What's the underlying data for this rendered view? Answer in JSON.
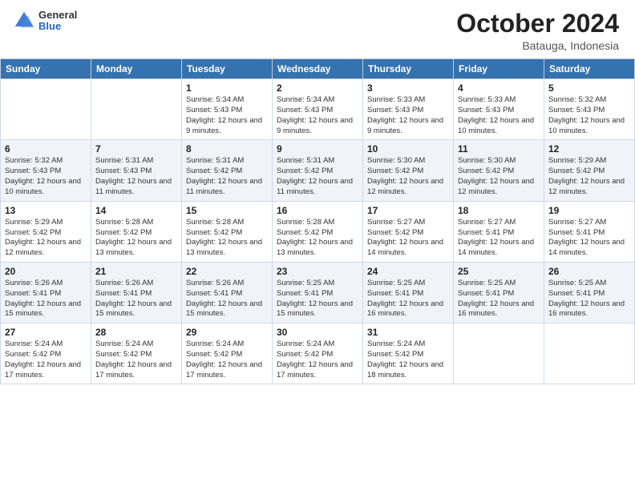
{
  "logo": {
    "general": "General",
    "blue": "Blue"
  },
  "header": {
    "month_year": "October 2024",
    "location": "Batauga, Indonesia"
  },
  "weekdays": [
    "Sunday",
    "Monday",
    "Tuesday",
    "Wednesday",
    "Thursday",
    "Friday",
    "Saturday"
  ],
  "weeks": [
    [
      {
        "day": "",
        "sunrise": "",
        "sunset": "",
        "daylight": ""
      },
      {
        "day": "",
        "sunrise": "",
        "sunset": "",
        "daylight": ""
      },
      {
        "day": "1",
        "sunrise": "Sunrise: 5:34 AM",
        "sunset": "Sunset: 5:43 PM",
        "daylight": "Daylight: 12 hours and 9 minutes."
      },
      {
        "day": "2",
        "sunrise": "Sunrise: 5:34 AM",
        "sunset": "Sunset: 5:43 PM",
        "daylight": "Daylight: 12 hours and 9 minutes."
      },
      {
        "day": "3",
        "sunrise": "Sunrise: 5:33 AM",
        "sunset": "Sunset: 5:43 PM",
        "daylight": "Daylight: 12 hours and 9 minutes."
      },
      {
        "day": "4",
        "sunrise": "Sunrise: 5:33 AM",
        "sunset": "Sunset: 5:43 PM",
        "daylight": "Daylight: 12 hours and 10 minutes."
      },
      {
        "day": "5",
        "sunrise": "Sunrise: 5:32 AM",
        "sunset": "Sunset: 5:43 PM",
        "daylight": "Daylight: 12 hours and 10 minutes."
      }
    ],
    [
      {
        "day": "6",
        "sunrise": "Sunrise: 5:32 AM",
        "sunset": "Sunset: 5:43 PM",
        "daylight": "Daylight: 12 hours and 10 minutes."
      },
      {
        "day": "7",
        "sunrise": "Sunrise: 5:31 AM",
        "sunset": "Sunset: 5:43 PM",
        "daylight": "Daylight: 12 hours and 11 minutes."
      },
      {
        "day": "8",
        "sunrise": "Sunrise: 5:31 AM",
        "sunset": "Sunset: 5:42 PM",
        "daylight": "Daylight: 12 hours and 11 minutes."
      },
      {
        "day": "9",
        "sunrise": "Sunrise: 5:31 AM",
        "sunset": "Sunset: 5:42 PM",
        "daylight": "Daylight: 12 hours and 11 minutes."
      },
      {
        "day": "10",
        "sunrise": "Sunrise: 5:30 AM",
        "sunset": "Sunset: 5:42 PM",
        "daylight": "Daylight: 12 hours and 12 minutes."
      },
      {
        "day": "11",
        "sunrise": "Sunrise: 5:30 AM",
        "sunset": "Sunset: 5:42 PM",
        "daylight": "Daylight: 12 hours and 12 minutes."
      },
      {
        "day": "12",
        "sunrise": "Sunrise: 5:29 AM",
        "sunset": "Sunset: 5:42 PM",
        "daylight": "Daylight: 12 hours and 12 minutes."
      }
    ],
    [
      {
        "day": "13",
        "sunrise": "Sunrise: 5:29 AM",
        "sunset": "Sunset: 5:42 PM",
        "daylight": "Daylight: 12 hours and 12 minutes."
      },
      {
        "day": "14",
        "sunrise": "Sunrise: 5:28 AM",
        "sunset": "Sunset: 5:42 PM",
        "daylight": "Daylight: 12 hours and 13 minutes."
      },
      {
        "day": "15",
        "sunrise": "Sunrise: 5:28 AM",
        "sunset": "Sunset: 5:42 PM",
        "daylight": "Daylight: 12 hours and 13 minutes."
      },
      {
        "day": "16",
        "sunrise": "Sunrise: 5:28 AM",
        "sunset": "Sunset: 5:42 PM",
        "daylight": "Daylight: 12 hours and 13 minutes."
      },
      {
        "day": "17",
        "sunrise": "Sunrise: 5:27 AM",
        "sunset": "Sunset: 5:42 PM",
        "daylight": "Daylight: 12 hours and 14 minutes."
      },
      {
        "day": "18",
        "sunrise": "Sunrise: 5:27 AM",
        "sunset": "Sunset: 5:41 PM",
        "daylight": "Daylight: 12 hours and 14 minutes."
      },
      {
        "day": "19",
        "sunrise": "Sunrise: 5:27 AM",
        "sunset": "Sunset: 5:41 PM",
        "daylight": "Daylight: 12 hours and 14 minutes."
      }
    ],
    [
      {
        "day": "20",
        "sunrise": "Sunrise: 5:26 AM",
        "sunset": "Sunset: 5:41 PM",
        "daylight": "Daylight: 12 hours and 15 minutes."
      },
      {
        "day": "21",
        "sunrise": "Sunrise: 5:26 AM",
        "sunset": "Sunset: 5:41 PM",
        "daylight": "Daylight: 12 hours and 15 minutes."
      },
      {
        "day": "22",
        "sunrise": "Sunrise: 5:26 AM",
        "sunset": "Sunset: 5:41 PM",
        "daylight": "Daylight: 12 hours and 15 minutes."
      },
      {
        "day": "23",
        "sunrise": "Sunrise: 5:25 AM",
        "sunset": "Sunset: 5:41 PM",
        "daylight": "Daylight: 12 hours and 15 minutes."
      },
      {
        "day": "24",
        "sunrise": "Sunrise: 5:25 AM",
        "sunset": "Sunset: 5:41 PM",
        "daylight": "Daylight: 12 hours and 16 minutes."
      },
      {
        "day": "25",
        "sunrise": "Sunrise: 5:25 AM",
        "sunset": "Sunset: 5:41 PM",
        "daylight": "Daylight: 12 hours and 16 minutes."
      },
      {
        "day": "26",
        "sunrise": "Sunrise: 5:25 AM",
        "sunset": "Sunset: 5:41 PM",
        "daylight": "Daylight: 12 hours and 16 minutes."
      }
    ],
    [
      {
        "day": "27",
        "sunrise": "Sunrise: 5:24 AM",
        "sunset": "Sunset: 5:42 PM",
        "daylight": "Daylight: 12 hours and 17 minutes."
      },
      {
        "day": "28",
        "sunrise": "Sunrise: 5:24 AM",
        "sunset": "Sunset: 5:42 PM",
        "daylight": "Daylight: 12 hours and 17 minutes."
      },
      {
        "day": "29",
        "sunrise": "Sunrise: 5:24 AM",
        "sunset": "Sunset: 5:42 PM",
        "daylight": "Daylight: 12 hours and 17 minutes."
      },
      {
        "day": "30",
        "sunrise": "Sunrise: 5:24 AM",
        "sunset": "Sunset: 5:42 PM",
        "daylight": "Daylight: 12 hours and 17 minutes."
      },
      {
        "day": "31",
        "sunrise": "Sunrise: 5:24 AM",
        "sunset": "Sunset: 5:42 PM",
        "daylight": "Daylight: 12 hours and 18 minutes."
      },
      {
        "day": "",
        "sunrise": "",
        "sunset": "",
        "daylight": ""
      },
      {
        "day": "",
        "sunrise": "",
        "sunset": "",
        "daylight": ""
      }
    ]
  ]
}
